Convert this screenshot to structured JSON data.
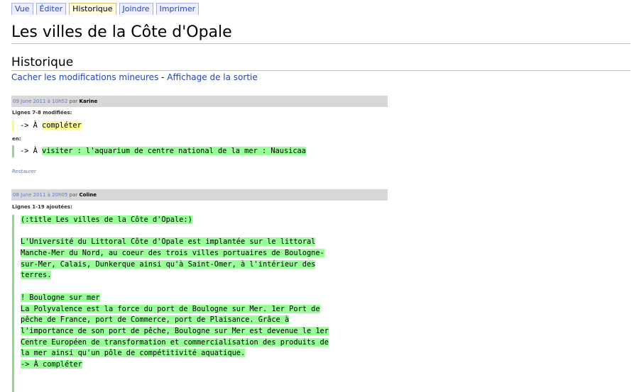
{
  "tabs": [
    {
      "label": "Vue"
    },
    {
      "label": "Éditer"
    },
    {
      "label": "Historique",
      "active": true
    },
    {
      "label": "Joindre"
    },
    {
      "label": "Imprimer"
    }
  ],
  "page_title": "Les villes de la Côte d'Opale",
  "section_title": "Historique",
  "links": {
    "hide_minor": "Cacher les modifications mineures",
    "separator": " - ",
    "output": "Affichage de la sortie"
  },
  "entries": [
    {
      "date": "09 June 2011 à 10h52",
      "by": "par",
      "user": "Karine",
      "label_changed": "Lignes 7-8 modifiées:",
      "old_prefix": "-> À ",
      "old_text": "compléter",
      "to_label": "en:",
      "new_prefix": "-> À ",
      "new_text": "visiter : l'aquarium de centre national de la mer : Nausicaa",
      "restore": "Restaurer"
    },
    {
      "date": "08 June 2011 à 20h05",
      "by": "par",
      "user": "Coline",
      "label_added": "Lignes 1-19 ajoutées:",
      "lines": [
        "(:title Les villes de la Côte d'Opale:)",
        "",
        "L'Université du Littoral Côte d'Opale est implantée sur le littoral",
        "Manche-Mer du Nord, au coeur des trois villes portuaires de Boulogne-",
        "sur-Mer, Calais, Dunkerque ainsi qu'à Saint-Omer, à l'intérieur des",
        "terres.",
        "",
        "! Boulogne sur mer",
        "La Polyvalence est la force du port de Boulogne sur Mer. 1er Port de",
        "pêche de France, port de Commerce, port de Plaisance. Grâce à",
        "l'importance de son port de pêche, Boulogne sur Mer est devenue le 1er",
        "Centre Européen de transformation et commercialisation des produits de",
        "la mer ainsi qu'un pôle de compétitivité aquatique.",
        "-> À compléter"
      ]
    }
  ]
}
